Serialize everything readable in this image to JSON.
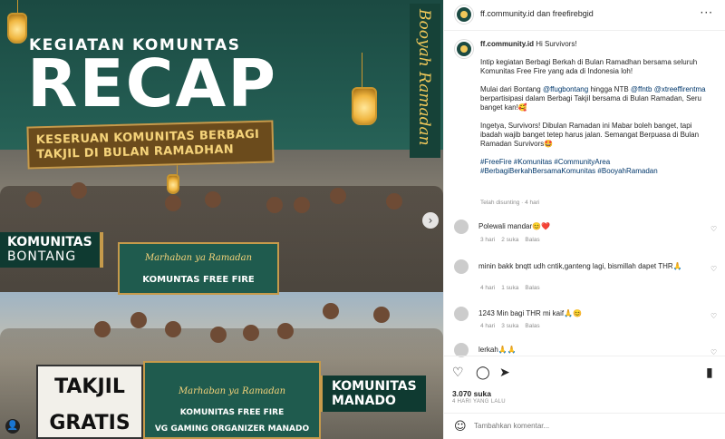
{
  "post_image": {
    "kicker": "KEGIATAN KOMUNTAS",
    "headline": "RECAP",
    "banner_line1": "KESERUAN KOMUNITAS BERBAGI",
    "banner_line2": "TAKJIL DI BULAN RAMADHAN",
    "vertical_text": "Booyah Ramadan",
    "tag_bontang_line1": "KOMUNITAS",
    "tag_bontang_line2": "BONTANG",
    "tag_manado_line1": "KOMUNITAS",
    "tag_manado_line2": "MANADO",
    "banner_marhaban": "Marhaban ya Ramadan",
    "banner_komunitas": "KOMUNTAS FREE FIRE",
    "banner_organizer": "VG GAMING ORGANIZER MANADO",
    "sign_line1": "TAKJIL",
    "sign_line2": "GRATIS",
    "bottom_tag_marhaban": "Marhaban ya Ramadan",
    "bottom_tag_komunitas": "KOMUNITAS FREE FIRE",
    "next_arrow": "›"
  },
  "header": {
    "account": "ff.community.id",
    "connector": "dan",
    "collab": "freefirebgid",
    "more": "···"
  },
  "caption": {
    "user": "ff.community.id",
    "greeting": "Hi Survivors!",
    "para1": "Intip kegiatan Berbagi Berkah di Bulan Ramadhan bersama seluruh Komunitas Free Fire yang ada di Indonesia loh!",
    "para2_a": "Mulai dari Bontang",
    "para2_m1": "@ffugbontang",
    "para2_b": "hingga NTB",
    "para2_m2": "@ffntb",
    "para2_m3": "@xtreeffirentma",
    "para2_c": "berpartisipasi dalam Berbagi Takjil bersama di Bulan Ramadan, Seru banget kan!🥰",
    "para3": "Ingetya, Survivors! Dibulan Ramadan ini Mabar boleh banget, tapi ibadah wajib banget tetep harus jalan. Semangat Berpuasa di Bulan Ramadan Survivors🤩",
    "hashtags1": "#FreeFire #Komunitas #CommunityArea",
    "hashtags2": "#BerbagiBerkahBersamaKomunitas #BooyahRamadan",
    "edited": "Telah disunting · 4 hari"
  },
  "comments": [
    {
      "text": "Polewali mandar😊❤️",
      "meta_time": "3 hari",
      "meta_likes": "2 suka",
      "meta_reply": "Balas"
    },
    {
      "text": "minin bakk bnqtt udh cntik,ganteng lagi, bismillah dapet THR🙏",
      "meta_time": "4 hari",
      "meta_likes": "1 suka",
      "meta_reply": "Balas"
    },
    {
      "text": "1243 Min bagi THR mi kaif🙏😊",
      "meta_time": "4 hari",
      "meta_likes": "3 suka",
      "meta_reply": "Balas"
    },
    {
      "text": "lerkah🙏🙏",
      "meta_time": "",
      "meta_likes": "",
      "meta_reply": ""
    }
  ],
  "actions": {
    "like_icon": "♡",
    "comment_icon": "◯",
    "share_icon": "➤",
    "save_icon": "▮",
    "likes": "3.070 suka",
    "date": "4 HARI YANG LALU",
    "emoji_icon": "☺",
    "comment_placeholder": "Tambahkan komentar..."
  }
}
